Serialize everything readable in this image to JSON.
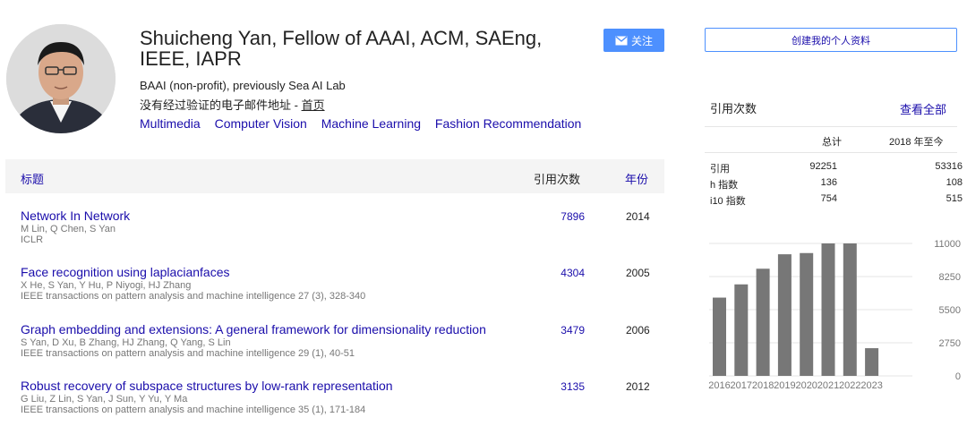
{
  "profile": {
    "name": "Shuicheng Yan, Fellow of AAAI, ACM, SAEng, IEEE, IAPR",
    "affiliation": "BAAI (non-profit), previously Sea AI Lab",
    "email_prefix": "没有经过验证的电子邮件地址 - ",
    "homepage_label": "首页",
    "interests": [
      "Multimedia",
      "Computer Vision",
      "Machine Learning",
      "Fashion Recommendation"
    ],
    "follow_label": "关注"
  },
  "table": {
    "col_title": "标题",
    "col_cited": "引用次数",
    "col_year": "年份",
    "articles": [
      {
        "title": "Network In Network",
        "authors": "M Lin, Q Chen, S Yan",
        "venue": "ICLR",
        "cited": "7896",
        "year": "2014"
      },
      {
        "title": "Face recognition using laplacianfaces",
        "authors": "X He, S Yan, Y Hu, P Niyogi, HJ Zhang",
        "venue": "IEEE transactions on pattern analysis and machine intelligence 27 (3), 328-340",
        "cited": "4304",
        "year": "2005"
      },
      {
        "title": "Graph embedding and extensions: A general framework for dimensionality reduction",
        "authors": "S Yan, D Xu, B Zhang, HJ Zhang, Q Yang, S Lin",
        "venue": "IEEE transactions on pattern analysis and machine intelligence 29 (1), 40-51",
        "cited": "3479",
        "year": "2006"
      },
      {
        "title": "Robust recovery of subspace structures by low-rank representation",
        "authors": "G Liu, Z Lin, S Yan, J Sun, Y Yu, Y Ma",
        "venue": "IEEE transactions on pattern analysis and machine intelligence 35 (1), 171-184",
        "cited": "3135",
        "year": "2012"
      }
    ]
  },
  "sidebar": {
    "create_profile_label": "创建我的个人资料",
    "citations_title": "引用次数",
    "view_all_label": "查看全部",
    "col_total": "总计",
    "col_since": "2018 年至今",
    "stats": [
      {
        "label": "引用",
        "total": "92251",
        "since": "53316"
      },
      {
        "label": "h 指数",
        "total": "136",
        "since": "108"
      },
      {
        "label": "i10 指数",
        "total": "754",
        "since": "515"
      }
    ]
  },
  "chart_data": {
    "type": "bar",
    "categories": [
      "2016",
      "2017",
      "2018",
      "2019",
      "2020",
      "2021",
      "2022",
      "2023"
    ],
    "values": [
      6500,
      7600,
      8900,
      10100,
      10200,
      11000,
      11000,
      2300
    ],
    "ylim": [
      0,
      11000
    ],
    "yticks": [
      "0",
      "2750",
      "5500",
      "8250",
      "11000"
    ],
    "bar_color": "#777777"
  },
  "colors": {
    "link": "#1a0dab",
    "accent": "#4d90fe",
    "header_bg": "#f4f4f4"
  }
}
